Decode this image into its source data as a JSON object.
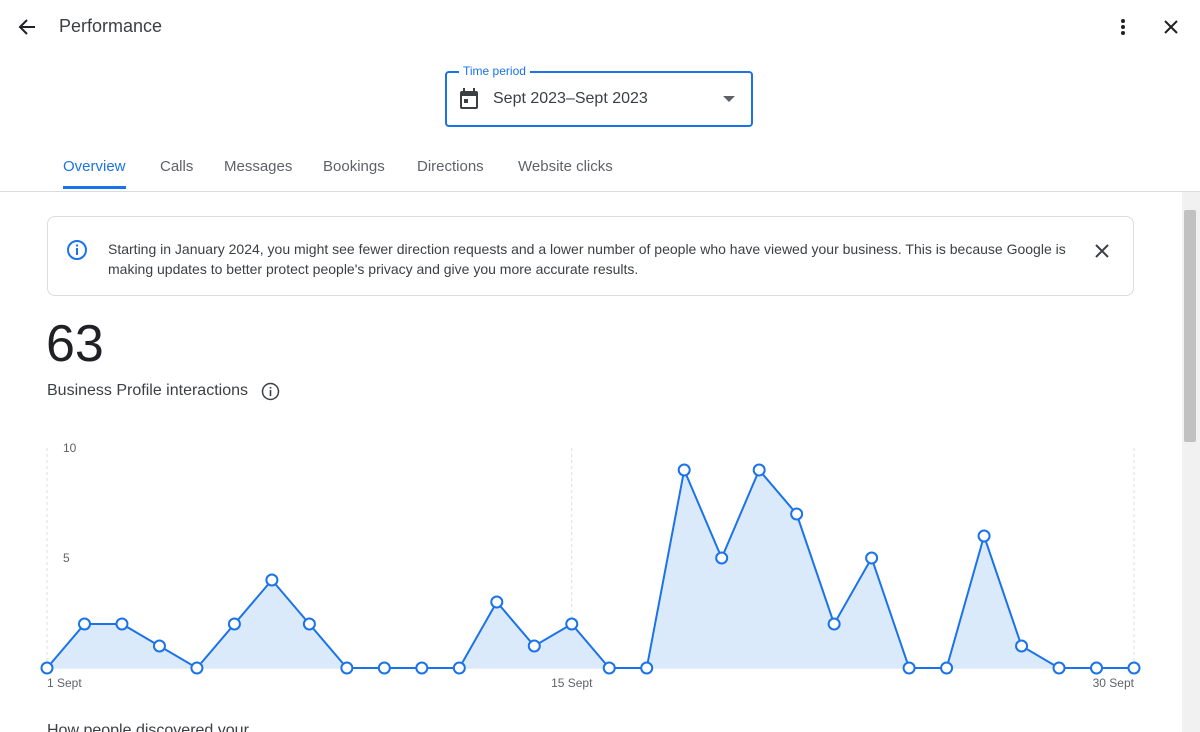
{
  "header": {
    "title": "Performance",
    "back_icon": "arrow-back-icon",
    "more_icon": "more-vert-icon",
    "close_icon": "close-icon"
  },
  "time_period": {
    "label": "Time period",
    "value": "Sept 2023–Sept 2023",
    "icon": "calendar-icon"
  },
  "tabs": [
    {
      "label": "Overview",
      "active": true
    },
    {
      "label": "Calls",
      "active": false
    },
    {
      "label": "Messages",
      "active": false
    },
    {
      "label": "Bookings",
      "active": false
    },
    {
      "label": "Directions",
      "active": false
    },
    {
      "label": "Website clicks",
      "active": false
    }
  ],
  "notice": {
    "text": "Starting in January 2024, you might see fewer direction requests and a lower number of people who have viewed your business. This is because Google is making updates to better protect people's privacy and give you more accurate results."
  },
  "metric": {
    "value": "63",
    "label": "Business Profile interactions"
  },
  "next_section": {
    "label": "How people discovered your"
  },
  "colors": {
    "accent": "#1a73e8",
    "line": "#1a73e8",
    "area": "#dbeafa"
  },
  "chart_data": {
    "type": "area",
    "x": [
      1,
      2,
      3,
      4,
      5,
      6,
      7,
      8,
      9,
      10,
      11,
      12,
      13,
      14,
      15,
      16,
      17,
      18,
      19,
      20,
      21,
      22,
      23,
      24,
      25,
      26,
      27,
      28,
      29,
      30
    ],
    "values": [
      0,
      2,
      2,
      1,
      0,
      2,
      4,
      2,
      0,
      0,
      0,
      0,
      3,
      1,
      2,
      0,
      0,
      9,
      5,
      9,
      7,
      2,
      5,
      0,
      0,
      6,
      1,
      0,
      0,
      0
    ],
    "ylim": [
      0,
      10
    ],
    "yticks": [
      5,
      10
    ],
    "xtick_labels": [
      {
        "x": 1,
        "label": "1 Sept"
      },
      {
        "x": 15,
        "label": "15 Sept"
      },
      {
        "x": 30,
        "label": "30 Sept"
      }
    ],
    "grid": "vertical dashed at labeled x ticks"
  }
}
